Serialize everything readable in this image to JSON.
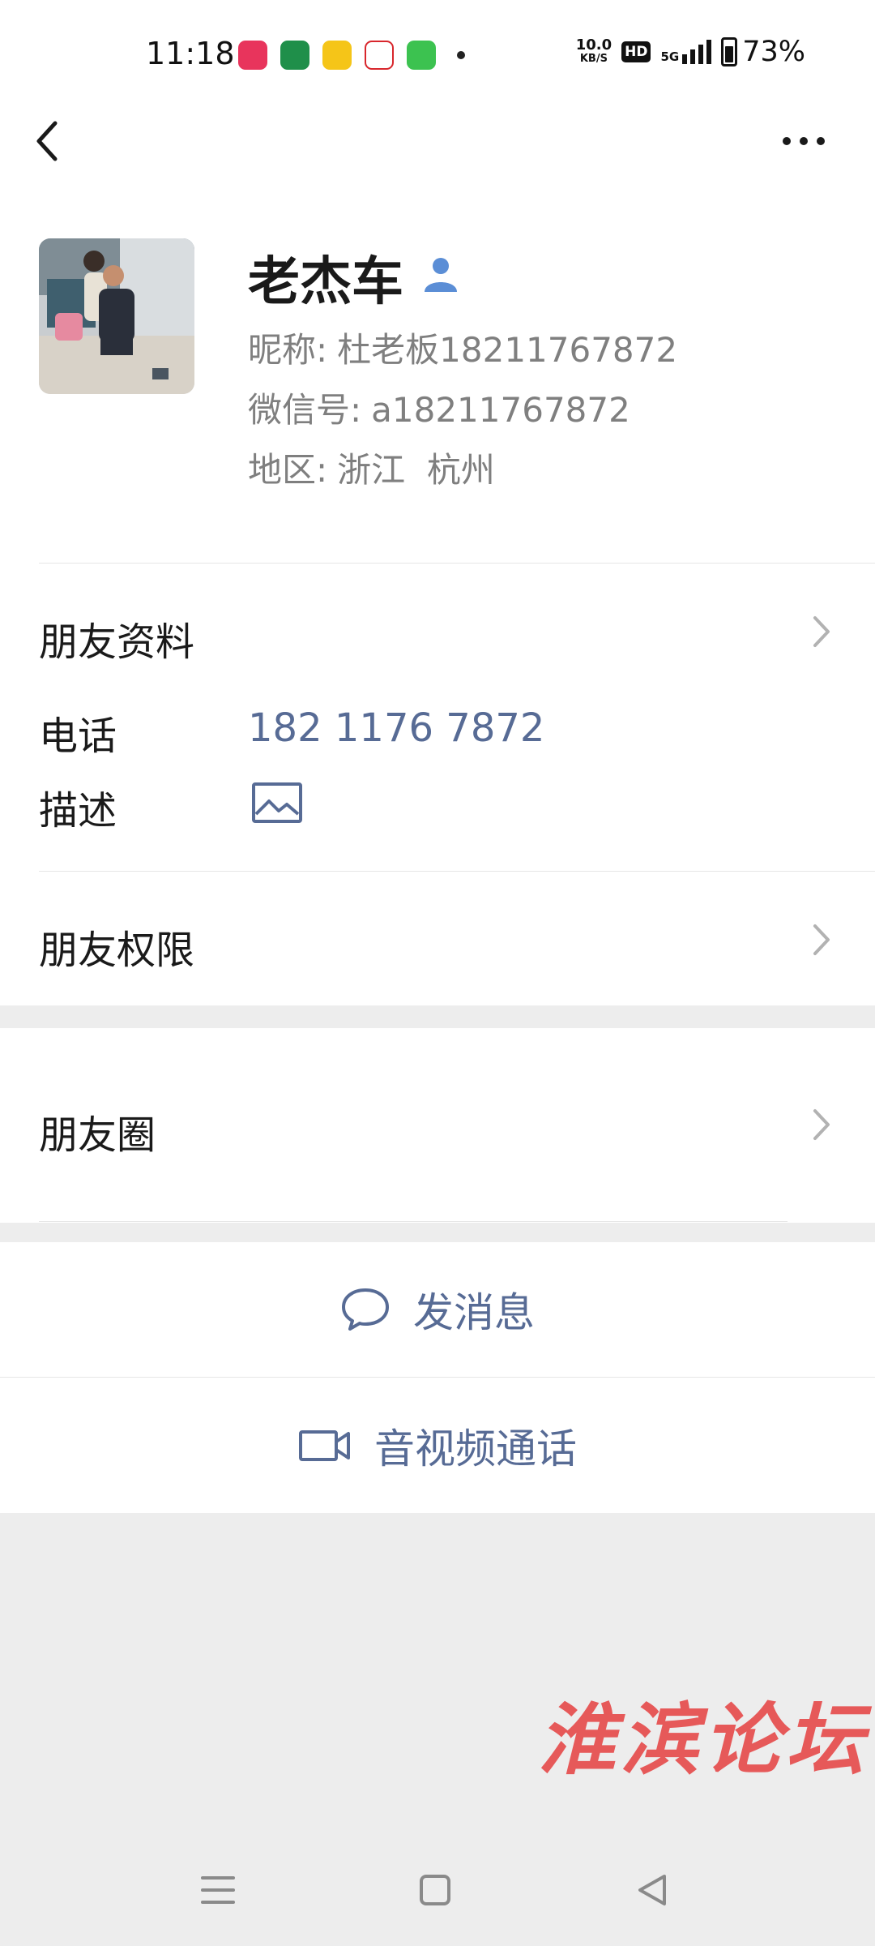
{
  "status_bar": {
    "time": "11:18",
    "network_speed": "10.0",
    "network_unit": "KB/S",
    "hd_label": "HD",
    "signal_label": "5G",
    "battery": "73%",
    "app_icon_colors": [
      "#e8345c",
      "#1f8f4a",
      "#f5c518",
      "#d8262c",
      "#3cc250"
    ]
  },
  "header": {
    "back_icon": "chevron-left-icon",
    "more_icon": "more-horizontal-icon"
  },
  "profile": {
    "name": "老杰车",
    "nickname_label": "昵称:",
    "nickname": "杜老板18211767872",
    "wechat_id_label": "微信号:",
    "wechat_id": "a18211767872",
    "region_label": "地区:",
    "region": "浙江  杭州"
  },
  "rows": {
    "friend_info": "朋友资料",
    "phone_label": "电话",
    "phone": "182 1176 7872",
    "description_label": "描述",
    "friend_permissions": "朋友权限",
    "moments": "朋友圈"
  },
  "actions": {
    "message": "发消息",
    "call": "音视频通话"
  },
  "watermark": "淮滨论坛",
  "colors": {
    "link": "#576b95",
    "watermark": "#e64545",
    "background": "#ededed"
  }
}
